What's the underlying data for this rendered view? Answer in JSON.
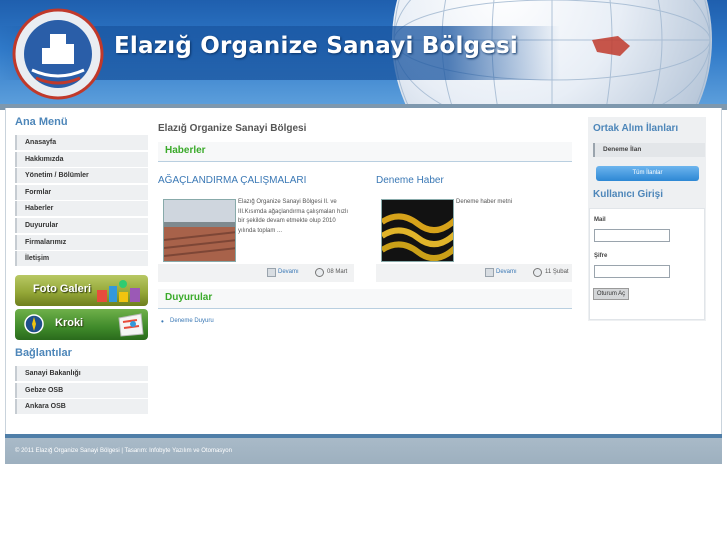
{
  "header": {
    "title": "Elazığ Organize Sanayi Bölgesi"
  },
  "colors": {
    "header_blue": "#2f79c8",
    "heading_blue": "#4d86b9",
    "section_green": "#3aaa2a",
    "link_blue": "#3a78b5",
    "footer_gray": "#a9bac8"
  },
  "left_sidebar": {
    "menu_title": "Ana Menü",
    "menu_items": [
      {
        "label": "Anasayfa"
      },
      {
        "label": "Hakkımızda"
      },
      {
        "label": "Yönetim / Bölümler"
      },
      {
        "label": "Formlar"
      },
      {
        "label": "Haberler"
      },
      {
        "label": "Duyurular"
      },
      {
        "label": "Firmalarımız"
      },
      {
        "label": "İletişim"
      }
    ],
    "banners": {
      "foto_galeri": "Foto Galeri",
      "kroki": "Kroki"
    },
    "links_title": "Bağlantılar",
    "links": [
      {
        "label": "Sanayi Bakanlığı"
      },
      {
        "label": "Gebze OSB"
      },
      {
        "label": "Ankara OSB"
      }
    ]
  },
  "main": {
    "breadcrumb": "Elazığ Organize Sanayi Bölgesi",
    "news_heading": "Haberler",
    "news": [
      {
        "title": "AĞAÇLANDIRMA ÇALIŞMALARI",
        "text": "Elazığ Organize Sanayi Bölgesi II. ve III.Kısımda ağaçlandırma çalışmaları hızlı bir şekilde devam etmekte olup 2010 yılında toplam ...",
        "more": "Devamı",
        "date": "08 Mart"
      },
      {
        "title": "Deneme Haber",
        "text": "Deneme haber metni",
        "more": "Devamı",
        "date": "11 Şubat"
      }
    ],
    "announcements_heading": "Duyurular",
    "announcements": [
      {
        "label": "Deneme Duyuru"
      }
    ]
  },
  "right_sidebar": {
    "ortak_title": "Ortak Alım İlanları",
    "ortak_items": [
      {
        "label": "Deneme İlan"
      }
    ],
    "all_button": "Tüm İlanlar",
    "login_title": "Kullanıcı Girişi",
    "mail_label": "Mail",
    "password_label": "Şifre",
    "mail_value": "",
    "password_value": "",
    "login_button": "Oturum Aç"
  },
  "footer": {
    "text": "© 2011 Elazığ Organize Sanayi Bölgesi | Tasarım: Infobyte Yazılım ve Otomasyon"
  }
}
